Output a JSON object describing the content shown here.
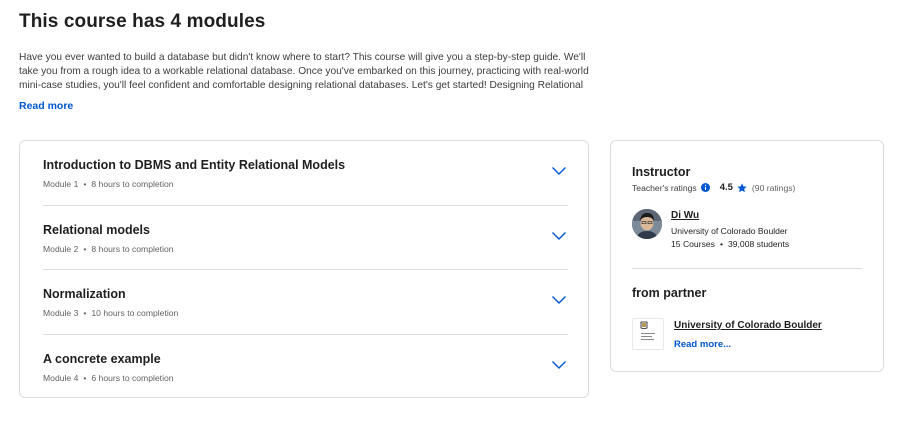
{
  "page": {
    "title": "This course has 4 modules",
    "description": "Have you ever wanted to build a database but didn't know where to start? This course will give you a step-by-step guide. We'll take you from a rough idea to a workable relational database. Once you've embarked on this journey, practicing with real-world mini-case studies, you'll feel confident and comfortable designing relational databases. Let's get started! Designing Relational Databases can be",
    "read_more": "Read more"
  },
  "modules": [
    {
      "title": "Introduction to DBMS and Entity Relational Models",
      "module": "Module 1",
      "duration": "8 hours to completion"
    },
    {
      "title": "Relational models",
      "module": "Module 2",
      "duration": "8 hours to completion"
    },
    {
      "title": "Normalization",
      "module": "Module 3",
      "duration": "10 hours to completion"
    },
    {
      "title": "A concrete example",
      "module": "Module 4",
      "duration": "6 hours to completion"
    }
  ],
  "instructor": {
    "heading": "Instructor",
    "ratings_label": "Teacher's ratings",
    "rating": "4.5",
    "rating_count": "(90 ratings)",
    "name": "Di Wu",
    "org": "University of Colorado Boulder",
    "courses": "15 Courses",
    "students": "39,008 students"
  },
  "partner": {
    "heading": "from partner",
    "name": "University of Colorado Boulder",
    "read_more": "Read more...",
    "logo_text": "University of Colorado Boulder"
  },
  "separator": "•",
  "colors": {
    "accent": "#0056d2",
    "border": "#dcdcdc",
    "text": "#1f1f1f",
    "muted": "#636363"
  },
  "icons": {
    "chevron": "chevron-down-icon",
    "info": "info-icon",
    "star": "star-icon"
  }
}
